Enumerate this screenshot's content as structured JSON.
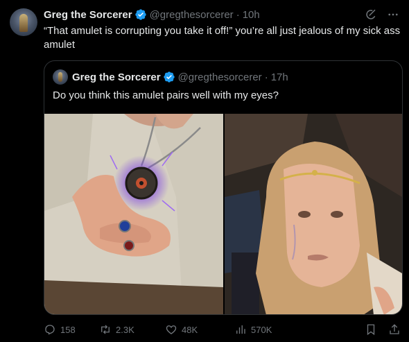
{
  "tweet": {
    "author_name": "Greg the Sorcerer",
    "handle": "@gregthesorcerer",
    "separator": "·",
    "time": "10h",
    "text": "“That amulet is corrupting you take it off!” you’re all just jealous of my sick ass amulet",
    "verified_color": "#1d9bf0"
  },
  "quoted_tweet": {
    "author_name": "Greg the Sorcerer",
    "handle": "@gregthesorcerer",
    "separator": "·",
    "time": "17h",
    "text": "Do you think this amulet pairs well with my eyes?"
  },
  "actions": {
    "replies": "158",
    "reposts": "2.3K",
    "likes": "48K",
    "views": "570K"
  },
  "icons": [
    "grok-icon",
    "more-icon",
    "reply-icon",
    "repost-icon",
    "like-icon",
    "views-icon",
    "bookmark-icon",
    "share-icon"
  ],
  "colors": {
    "background": "#000000",
    "text": "#e7e9ea",
    "muted": "#71767b",
    "border": "#2f3336"
  }
}
